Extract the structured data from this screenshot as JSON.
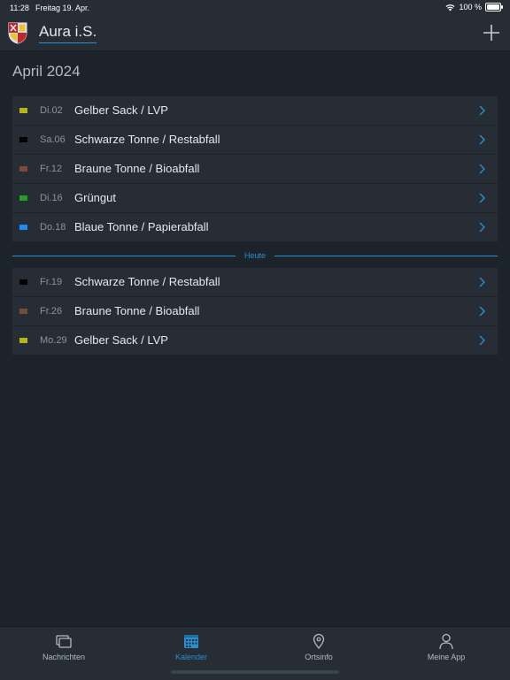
{
  "status_bar": {
    "time": "11:28",
    "date": "Freitag 19. Apr.",
    "battery": "100 %",
    "wifi_icon": "wifi-icon",
    "battery_icon": "battery-icon"
  },
  "header": {
    "title": "Aura i.S.",
    "logo_icon": "coat-of-arms-icon",
    "add_icon": "plus-icon",
    "accent_color": "#2a8fd0"
  },
  "calendar": {
    "month": "April 2024",
    "today_label": "Heute",
    "past": [
      {
        "date": "Di.02",
        "label": "Gelber Sack / LVP",
        "color": "#b5b51a"
      },
      {
        "date": "Sa.06",
        "label": "Schwarze Tonne / Restabfall",
        "color": "#000000"
      },
      {
        "date": "Fr.12",
        "label": "Braune Tonne / Bioabfall",
        "color": "#7a4a3a"
      },
      {
        "date": "Di.16",
        "label": "Grüngut",
        "color": "#22a022"
      },
      {
        "date": "Do.18",
        "label": "Blaue Tonne / Papierabfall",
        "color": "#1a8ef0"
      }
    ],
    "upcoming": [
      {
        "date": "Fr.19",
        "label": "Schwarze Tonne / Restabfall",
        "color": "#000000"
      },
      {
        "date": "Fr.26",
        "label": "Braune Tonne / Bioabfall",
        "color": "#7a4a3a"
      },
      {
        "date": "Mo.29",
        "label": "Gelber Sack / LVP",
        "color": "#b5b51a"
      }
    ]
  },
  "tabs": [
    {
      "label": "Nachrichten",
      "icon": "news-icon",
      "active": false
    },
    {
      "label": "Kalender",
      "icon": "calendar-icon",
      "active": true
    },
    {
      "label": "Ortsinfo",
      "icon": "location-pin-icon",
      "active": false
    },
    {
      "label": "Meine App",
      "icon": "person-icon",
      "active": false
    }
  ]
}
